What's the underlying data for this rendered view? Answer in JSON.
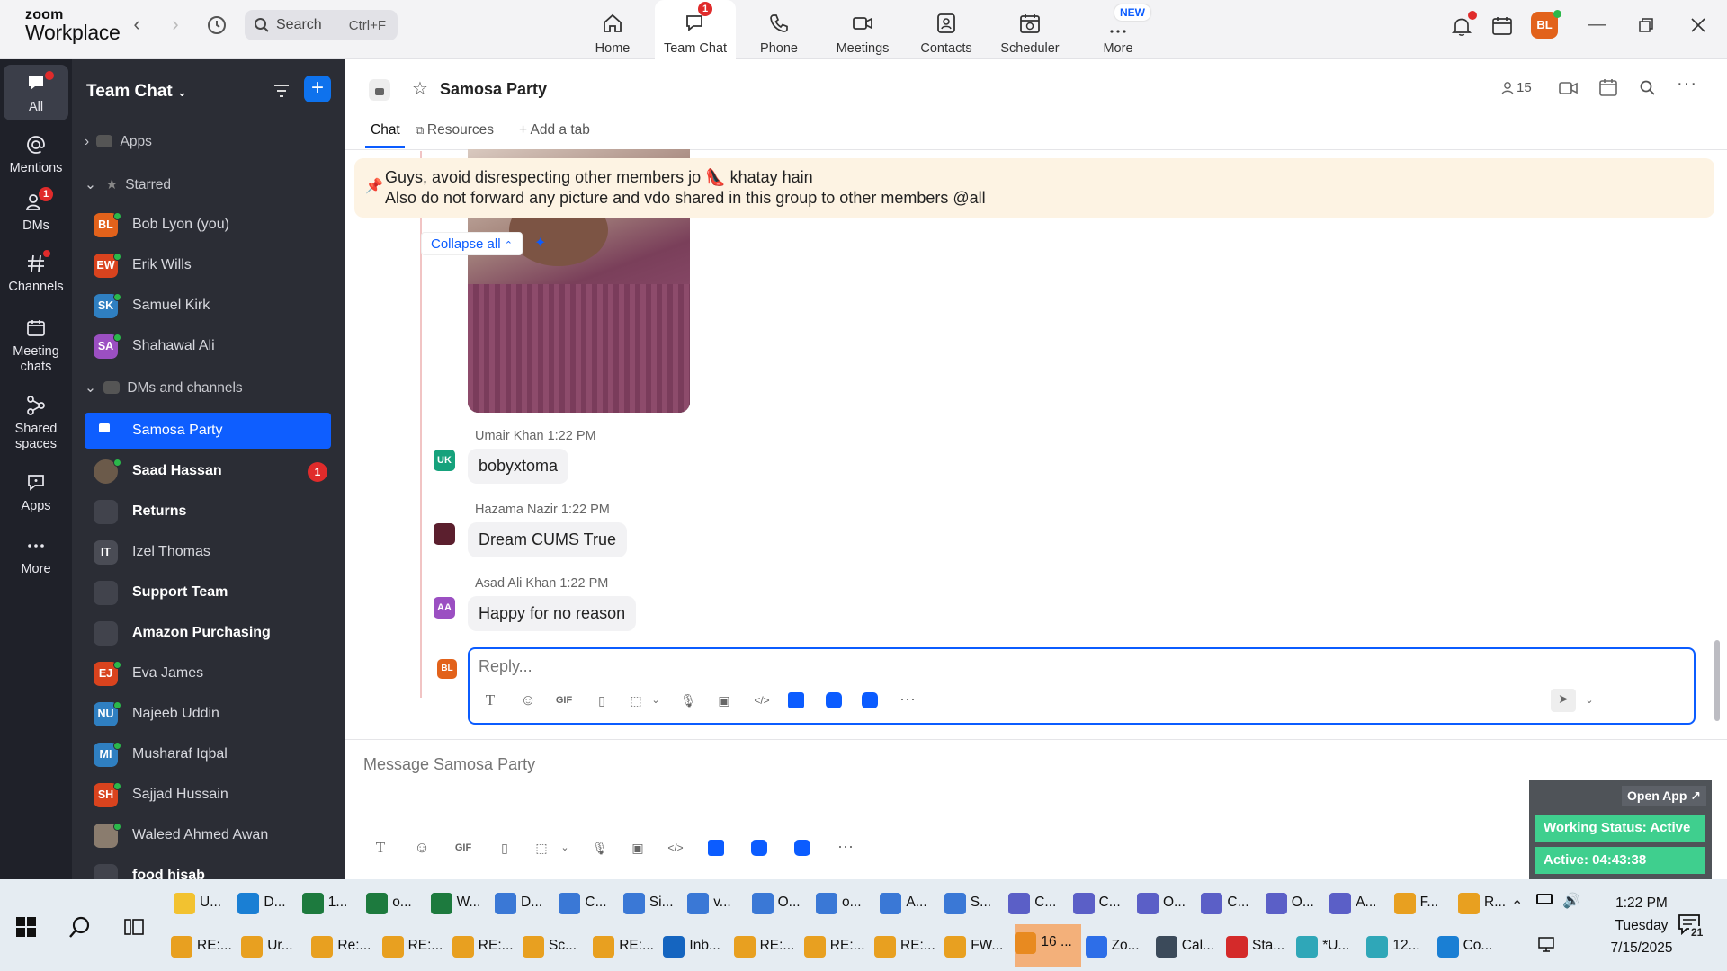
{
  "app": {
    "logo_line1": "zoom",
    "logo_line2": "Workplace"
  },
  "search": {
    "label": "Search",
    "shortcut": "Ctrl+F"
  },
  "nav_tabs": [
    {
      "label": "Home"
    },
    {
      "label": "Team Chat",
      "badge": "1"
    },
    {
      "label": "Phone"
    },
    {
      "label": "Meetings"
    },
    {
      "label": "Contacts"
    },
    {
      "label": "Scheduler"
    },
    {
      "label": "More",
      "pill": "NEW"
    }
  ],
  "user_avatar": "BL",
  "rail": [
    {
      "label": "All"
    },
    {
      "label": "Mentions"
    },
    {
      "label": "DMs",
      "badge": "1"
    },
    {
      "label": "Channels"
    },
    {
      "label": "Meeting chats"
    },
    {
      "label": "Shared spaces"
    },
    {
      "label": "Apps"
    },
    {
      "label": "More"
    }
  ],
  "sidebar": {
    "title": "Team Chat",
    "apps_label": "Apps",
    "starred_label": "Starred",
    "dms_label": "DMs and channels",
    "starred": [
      {
        "initials": "BL",
        "name": "Bob Lyon (you)",
        "color": "#e2621b"
      },
      {
        "initials": "EW",
        "name": "Erik Wills",
        "color": "#d9431e"
      },
      {
        "initials": "SK",
        "name": "Samuel Kirk",
        "color": "#2f7fc1"
      },
      {
        "initials": "SA",
        "name": "Shahawal Ali",
        "color": "#9b4fc2"
      }
    ],
    "channels": [
      {
        "name": "Samosa Party",
        "type": "lock"
      },
      {
        "name": "Saad Hassan",
        "type": "photo",
        "badge": "1"
      },
      {
        "name": "Returns",
        "type": "lock"
      },
      {
        "initials": "IT",
        "name": "Izel Thomas",
        "type": "av",
        "color": "#4a4c55"
      },
      {
        "name": "Support Team",
        "type": "lock"
      },
      {
        "name": "Amazon Purchasing",
        "type": "lock"
      },
      {
        "initials": "EJ",
        "name": "Eva James",
        "type": "av",
        "color": "#d9431e"
      },
      {
        "initials": "NU",
        "name": "Najeeb Uddin",
        "type": "av",
        "color": "#2f7fc1"
      },
      {
        "initials": "MI",
        "name": "Musharaf Iqbal",
        "type": "av",
        "color": "#2f7fc1"
      },
      {
        "initials": "SH",
        "name": "Sajjad Hussain",
        "type": "av",
        "color": "#d9431e"
      },
      {
        "name": "Waleed Ahmed Awan",
        "type": "photo"
      },
      {
        "name": "food hisab",
        "type": "lock"
      }
    ]
  },
  "channel": {
    "title": "Samosa Party",
    "member_count": "15",
    "tabs": [
      "Chat",
      "Resources",
      "Add a tab"
    ],
    "pinned_line1": "Guys, avoid disrespecting other members jo 👠 khatay hain",
    "pinned_line2": "Also do not forward any picture and vdo shared in this group to other members @all",
    "collapse_all": "Collapse all",
    "messages": [
      {
        "initials": "UK",
        "author": "Umair Khan",
        "time": "1:22 PM",
        "text": "bobyxtoma",
        "color": "#16a27c"
      },
      {
        "initials": "",
        "author": "Hazama Nazir",
        "time": "1:22 PM",
        "text": "Dream CUMS True",
        "color": "#5b1f2e"
      },
      {
        "initials": "AA",
        "author": "Asad Ali Khan",
        "time": "1:22 PM",
        "text": "Happy for no reason",
        "color": "#9b4fc2"
      }
    ],
    "reply_avatar": "BL",
    "reply_placeholder": "Reply...",
    "composer_placeholder": "Message Samosa Party"
  },
  "floater": {
    "open_app": "Open App ↗",
    "status": "Working Status: Active",
    "active": "Active: 04:43:38"
  },
  "taskbar": {
    "row1": [
      "U...",
      "D...",
      "1...",
      "o...",
      "W...",
      "D...",
      "C...",
      "Si...",
      "v...",
      "O...",
      "o...",
      "A...",
      "S...",
      "C...",
      "C...",
      "O...",
      "C...",
      "O...",
      "A...",
      "F...",
      "R..."
    ],
    "row2": [
      "RE:...",
      "Ur...",
      "Re:...",
      "RE:...",
      "RE:...",
      "Sc...",
      "RE:...",
      "Inb...",
      "RE:...",
      "RE:...",
      "RE:...",
      "FW...",
      "16 ...",
      "Zo...",
      "Cal...",
      "Sta...",
      "*U...",
      "12...",
      "Co..."
    ],
    "time": "1:22 PM",
    "day": "Tuesday",
    "date": "7/15/2025",
    "notif_count": "21"
  }
}
